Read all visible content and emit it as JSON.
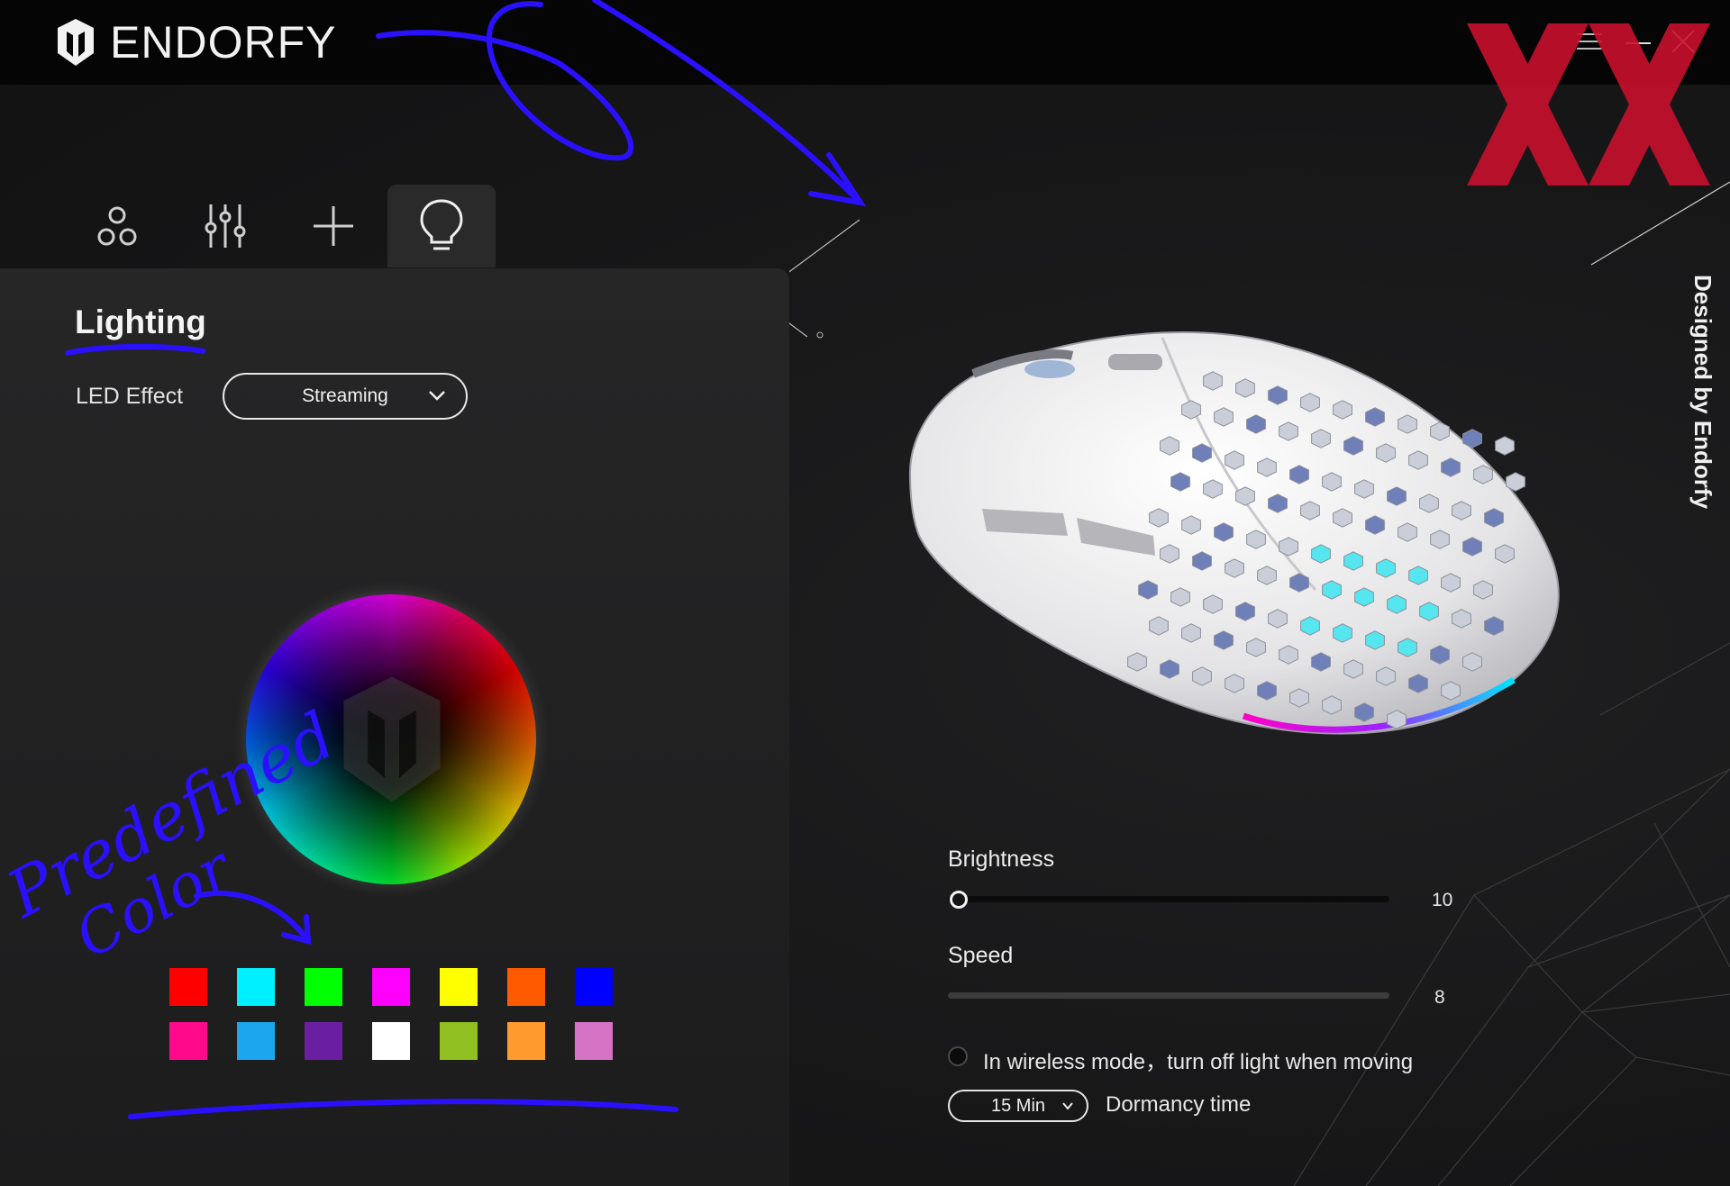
{
  "app": {
    "brand": "ENDORFY",
    "side_text": "Designed by Endorfy"
  },
  "tabs": [
    {
      "icon": "profiles-icon",
      "active": false
    },
    {
      "icon": "sliders-icon",
      "active": false
    },
    {
      "icon": "plus-icon",
      "active": false
    },
    {
      "icon": "bulb-icon",
      "active": true
    }
  ],
  "lighting": {
    "title": "Lighting",
    "led_effect_label": "LED Effect",
    "led_effect_value": "Streaming"
  },
  "annotation": {
    "text_line1": "Predefined",
    "text_line2": "Color"
  },
  "swatches": [
    "#ff0000",
    "#00f0ff",
    "#00ff00",
    "#ff00ff",
    "#ffff00",
    "#ff5a00",
    "#0000ff",
    "#ff0a8a",
    "#1ca6ee",
    "#6a1fa2",
    "#ffffff",
    "#8fbf20",
    "#ff9a2e",
    "#d773c4"
  ],
  "brightness": {
    "label": "Brightness",
    "value": "10",
    "level": 0.0
  },
  "speed": {
    "label": "Speed",
    "value": "8"
  },
  "wireless": {
    "label": "In wireless mode，turn off light when moving"
  },
  "dormancy": {
    "value": "15 Min",
    "label": "Dormancy time"
  },
  "colors": {
    "accent_scribble": "#2a10ff",
    "watermark": "#c8102e"
  }
}
